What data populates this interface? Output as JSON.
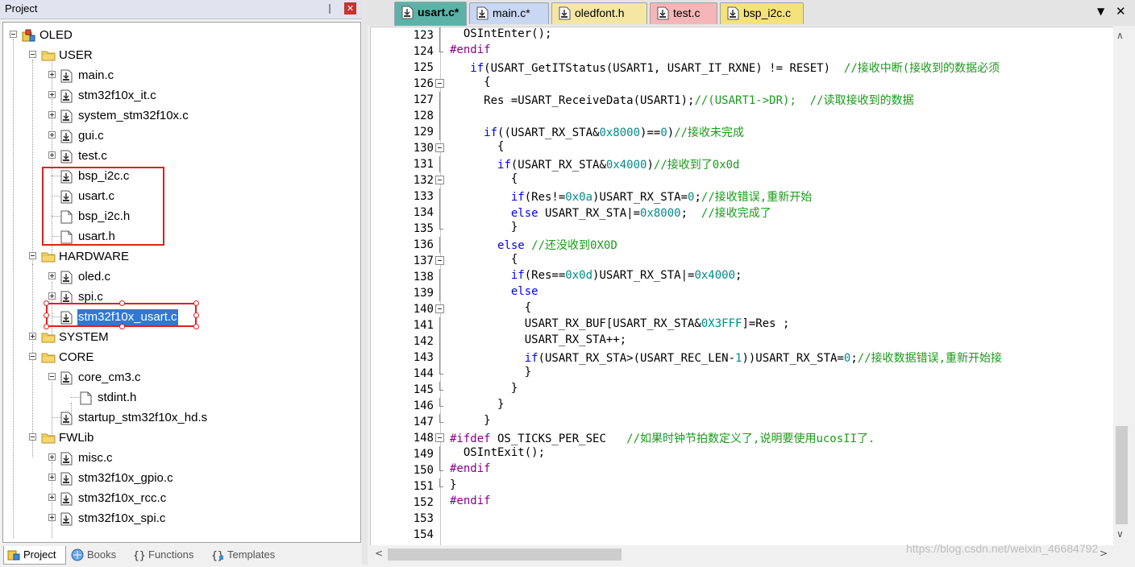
{
  "project_pane": {
    "title": "Project",
    "pin_glyph": "❘",
    "close_glyph": "✕",
    "tree": [
      {
        "label": "OLED",
        "icon": "project-root-icon",
        "depth": 0,
        "toggle": "minus"
      },
      {
        "label": "USER",
        "icon": "folder-icon",
        "depth": 1,
        "toggle": "minus"
      },
      {
        "label": "main.c",
        "icon": "c-file-icon",
        "depth": 2,
        "toggle": "plus"
      },
      {
        "label": "stm32f10x_it.c",
        "icon": "c-file-icon",
        "depth": 2,
        "toggle": "plus"
      },
      {
        "label": "system_stm32f10x.c",
        "icon": "c-file-icon",
        "depth": 2,
        "toggle": "plus"
      },
      {
        "label": "gui.c",
        "icon": "c-file-icon",
        "depth": 2,
        "toggle": "plus"
      },
      {
        "label": "test.c",
        "icon": "c-file-icon",
        "depth": 2,
        "toggle": "plus"
      },
      {
        "label": "bsp_i2c.c",
        "icon": "c-file-icon",
        "depth": 2,
        "toggle": "none"
      },
      {
        "label": "usart.c",
        "icon": "c-file-icon",
        "depth": 2,
        "toggle": "none"
      },
      {
        "label": "bsp_i2c.h",
        "icon": "h-file-icon",
        "depth": 2,
        "toggle": "none"
      },
      {
        "label": "usart.h",
        "icon": "h-file-icon",
        "depth": 2,
        "toggle": "none"
      },
      {
        "label": "HARDWARE",
        "icon": "folder-icon",
        "depth": 1,
        "toggle": "minus"
      },
      {
        "label": "oled.c",
        "icon": "c-file-icon",
        "depth": 2,
        "toggle": "plus"
      },
      {
        "label": "spi.c",
        "icon": "c-file-icon",
        "depth": 2,
        "toggle": "plus"
      },
      {
        "label": "stm32f10x_usart.c",
        "icon": "c-file-icon",
        "depth": 2,
        "toggle": "none",
        "selected": true
      },
      {
        "label": "SYSTEM",
        "icon": "folder-icon",
        "depth": 1,
        "toggle": "plus"
      },
      {
        "label": "CORE",
        "icon": "folder-icon",
        "depth": 1,
        "toggle": "minus"
      },
      {
        "label": "core_cm3.c",
        "icon": "c-file-icon",
        "depth": 2,
        "toggle": "minus"
      },
      {
        "label": "stdint.h",
        "icon": "h-file-icon",
        "depth": 3,
        "toggle": "none"
      },
      {
        "label": "startup_stm32f10x_hd.s",
        "icon": "c-file-icon",
        "depth": 2,
        "toggle": "none"
      },
      {
        "label": "FWLib",
        "icon": "folder-icon",
        "depth": 1,
        "toggle": "minus"
      },
      {
        "label": "misc.c",
        "icon": "c-file-icon",
        "depth": 2,
        "toggle": "plus"
      },
      {
        "label": "stm32f10x_gpio.c",
        "icon": "c-file-icon",
        "depth": 2,
        "toggle": "plus"
      },
      {
        "label": "stm32f10x_rcc.c",
        "icon": "c-file-icon",
        "depth": 2,
        "toggle": "plus"
      },
      {
        "label": "stm32f10x_spi.c",
        "icon": "c-file-icon",
        "depth": 2,
        "toggle": "plus"
      }
    ],
    "bottom_tabs": [
      {
        "label": "Project",
        "icon": "project-tab-icon",
        "active": true
      },
      {
        "label": "Books",
        "icon": "books-icon",
        "active": false
      },
      {
        "label": "Functions",
        "icon": "functions-icon",
        "active": false
      },
      {
        "label": "Templates",
        "icon": "templates-icon",
        "active": false
      }
    ]
  },
  "editor": {
    "tabs": [
      {
        "label": "usart.c*",
        "active": true,
        "color": "#5bb3a7"
      },
      {
        "label": "main.c*",
        "active": false,
        "color": "#c9d8f2"
      },
      {
        "label": "oledfont.h",
        "active": false,
        "color": "#f4e7a4"
      },
      {
        "label": "test.c",
        "active": false,
        "color": "#f4b6b6"
      },
      {
        "label": "bsp_i2c.c",
        "active": false,
        "color": "#f4e27a"
      }
    ],
    "tab_menu_glyph": "▼",
    "tab_close_glyph": "✕",
    "lines": [
      {
        "n": "123",
        "fold": "line",
        "code": "  OSIntEnter();"
      },
      {
        "n": "124",
        "fold": "end",
        "code": "#endif"
      },
      {
        "n": "125",
        "fold": "none",
        "code": "   if(USART_GetITStatus(USART1, USART_IT_RXNE) != RESET)  //接收中断(接收到的数据必须"
      },
      {
        "n": "126",
        "fold": "start",
        "code": "     {"
      },
      {
        "n": "127",
        "fold": "line",
        "code": "     Res =USART_ReceiveData(USART1);//(USART1->DR);  //读取接收到的数据"
      },
      {
        "n": "128",
        "fold": "line",
        "code": ""
      },
      {
        "n": "129",
        "fold": "line",
        "code": "     if((USART_RX_STA&0x8000)==0)//接收未完成"
      },
      {
        "n": "130",
        "fold": "start",
        "code": "       {"
      },
      {
        "n": "131",
        "fold": "line",
        "code": "       if(USART_RX_STA&0x4000)//接收到了0x0d"
      },
      {
        "n": "132",
        "fold": "start",
        "code": "         {"
      },
      {
        "n": "133",
        "fold": "line",
        "code": "         if(Res!=0x0a)USART_RX_STA=0;//接收错误,重新开始"
      },
      {
        "n": "134",
        "fold": "line",
        "code": "         else USART_RX_STA|=0x8000;  //接收完成了"
      },
      {
        "n": "135",
        "fold": "end",
        "code": "         }"
      },
      {
        "n": "136",
        "fold": "line",
        "code": "       else //还没收到0X0D"
      },
      {
        "n": "137",
        "fold": "start",
        "code": "         {"
      },
      {
        "n": "138",
        "fold": "line",
        "code": "         if(Res==0x0d)USART_RX_STA|=0x4000;"
      },
      {
        "n": "139",
        "fold": "line",
        "code": "         else"
      },
      {
        "n": "140",
        "fold": "start",
        "code": "           {"
      },
      {
        "n": "141",
        "fold": "line",
        "code": "           USART_RX_BUF[USART_RX_STA&0X3FFF]=Res ;"
      },
      {
        "n": "142",
        "fold": "line",
        "code": "           USART_RX_STA++;"
      },
      {
        "n": "143",
        "fold": "line",
        "code": "           if(USART_RX_STA>(USART_REC_LEN-1))USART_RX_STA=0;//接收数据错误,重新开始接"
      },
      {
        "n": "144",
        "fold": "end",
        "code": "           }"
      },
      {
        "n": "145",
        "fold": "end",
        "code": "         }"
      },
      {
        "n": "146",
        "fold": "end",
        "code": "       }"
      },
      {
        "n": "147",
        "fold": "end",
        "code": "     }"
      },
      {
        "n": "148",
        "fold": "start",
        "code": "#ifdef OS_TICKS_PER_SEC   //如果时钟节拍数定义了,说明要使用ucosII了."
      },
      {
        "n": "149",
        "fold": "line",
        "code": "  OSIntExit();"
      },
      {
        "n": "150",
        "fold": "end",
        "code": "#endif"
      },
      {
        "n": "151",
        "fold": "end",
        "code": "}"
      },
      {
        "n": "152",
        "fold": "none",
        "code": "#endif"
      },
      {
        "n": "153",
        "fold": "none",
        "code": ""
      },
      {
        "n": "154",
        "fold": "none",
        "code": ""
      }
    ],
    "scroll": {
      "up": "∧",
      "down": "∨",
      "left": "<",
      "right": ">"
    },
    "watermark": "https://blog.csdn.net/weixin_46684792"
  },
  "colors": {
    "keyword": "#0000ff",
    "number": "#008b8b",
    "comment": "#1a9a1a",
    "preprocessor": "#8b008b",
    "selection": "#3178d4",
    "annotation": "#e02020"
  }
}
